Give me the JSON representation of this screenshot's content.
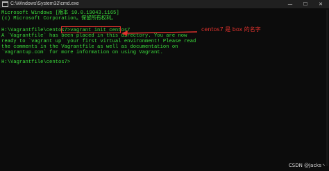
{
  "window": {
    "title": "C:\\Windows\\System32\\cmd.exe",
    "buttons": {
      "minimize": "—",
      "maximize": "☐",
      "close": "✕"
    }
  },
  "console": {
    "lines": [
      "Microsoft Windows [版本 10.0.19043.1165]",
      "(c) Microsoft Corporation。保留所有权利。",
      "",
      "H:\\Vagrantfile\\centos7>vagrant init centos7",
      "A `Vagrantfile` has been placed in this directory. You are now",
      "ready to `vagrant up` your first virtual environment! Please read",
      "the comments in the Vagrantfile as well as documentation on",
      "`vagrantup.com` for more information on using Vagrant.",
      "",
      "H:\\Vagrantfile\\centos7>"
    ]
  },
  "annotation": {
    "text": "centos7 是 box 的名字",
    "color": "#e0322d"
  },
  "watermark": "CSDN @Jacks丶",
  "colors": {
    "console_text": "#3bdc3b",
    "background": "#0c0c0c",
    "titlebar": "#202020"
  }
}
